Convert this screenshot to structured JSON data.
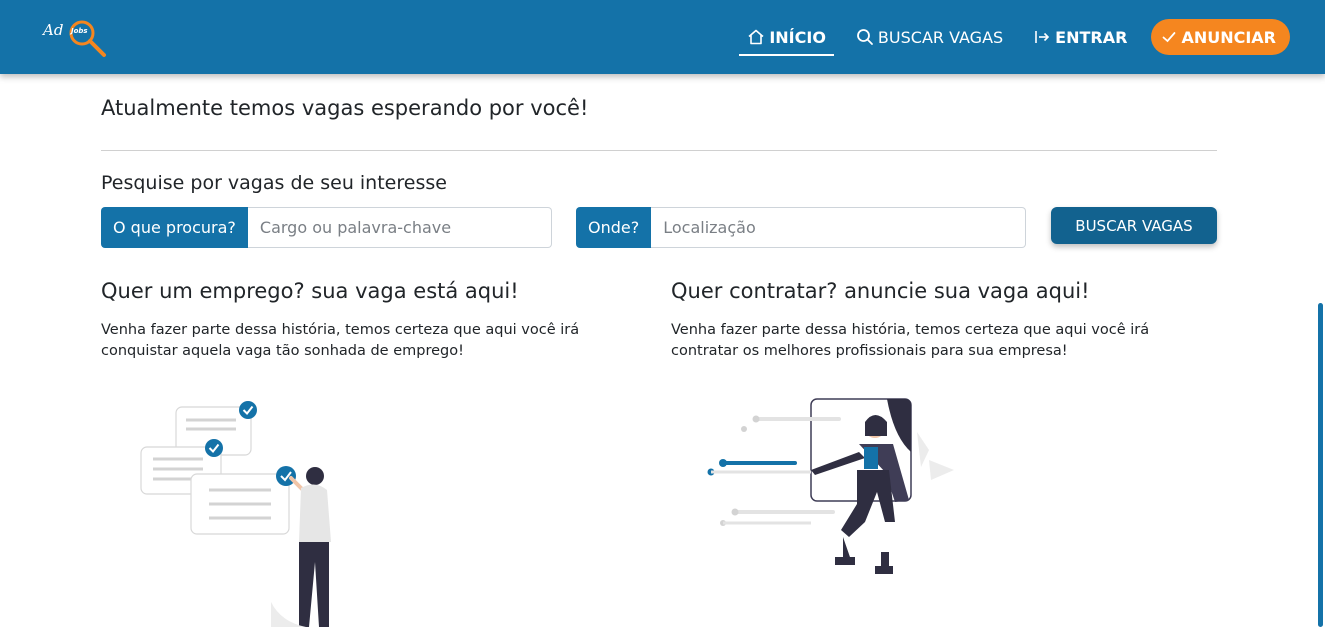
{
  "nav": {
    "logo_text": "Ad",
    "logo_badge": "Jobs",
    "items": [
      {
        "label": "INÍCIO",
        "icon": "home-icon",
        "active": true
      },
      {
        "label": "BUSCAR VAGAS",
        "icon": "search-icon",
        "active": false
      },
      {
        "label": "ENTRAR",
        "icon": "login-icon",
        "active": false
      },
      {
        "label": "ANUNCIAR",
        "icon": "check-icon",
        "active": false
      }
    ]
  },
  "main": {
    "headline": "Atualmente temos vagas esperando por você!",
    "search_title": "Pesquise por vagas de seu interesse",
    "what": {
      "label": "O que procura?",
      "placeholder": "Cargo ou palavra-chave"
    },
    "where": {
      "label": "Onde?",
      "placeholder": "Localização"
    },
    "search_button": "BUSCAR VAGAS"
  },
  "columns": [
    {
      "title": "Quer um emprego? sua vaga está aqui!",
      "text": "Venha fazer parte dessa história, temos certeza que aqui você irá conquistar aquela vaga tão sonhada de emprego!"
    },
    {
      "title": "Quer contratar? anuncie sua vaga aqui!",
      "text": "Venha fazer parte dessa história, temos certeza que aqui você irá contratar os melhores profissionais para sua empresa!"
    }
  ],
  "colors": {
    "primary": "#1472a8",
    "accent": "#f5861f",
    "button": "#12628f"
  }
}
